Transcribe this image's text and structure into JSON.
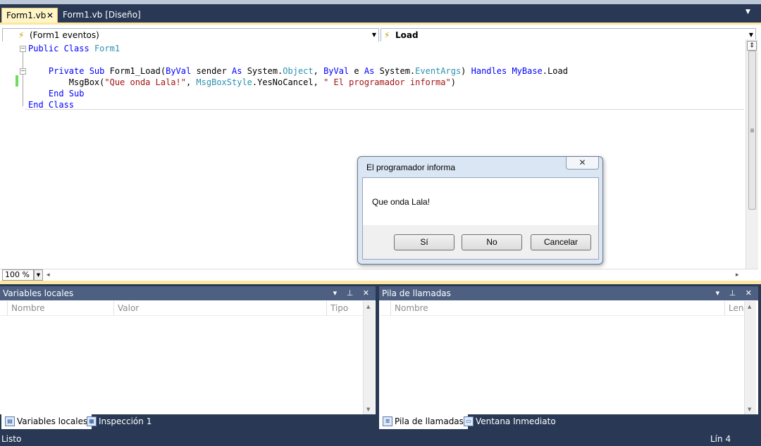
{
  "doc_tabs": {
    "active": "Form1.vb",
    "active_close": "✕",
    "inactive": "Form1.vb [Diseño]"
  },
  "nav": {
    "class_combo": "(Form1 eventos)",
    "method_combo": "Load"
  },
  "code": {
    "line1": {
      "kw1": "Public Class",
      "name": "Form1"
    },
    "line3": {
      "a": "Private Sub",
      "b": " Form1_Load(",
      "c": "ByVal",
      "d": " sender ",
      "e": "As",
      "f": " System.",
      "g": "Object",
      "h": ", ",
      "i": "ByVal",
      "j": " e ",
      "k": "As",
      "l": " System.",
      "m": "EventArgs",
      "n": ") ",
      "o": "Handles",
      "p": " ",
      "q": "MyBase",
      "r": ".Load"
    },
    "line4": {
      "a": "MsgBox(",
      "b": "\"Que onda Lala!\"",
      "c": ", ",
      "d": "MsgBoxStyle",
      "e": ".YesNoCancel, ",
      "f": "\" El programador informa\"",
      "g": ")"
    },
    "line5": "End Sub",
    "line6": "End Class"
  },
  "zoom": "100 %",
  "panes": {
    "locals": {
      "title": "Variables locales",
      "tools": "▾ ⊥ ✕",
      "columns": [
        "Nombre",
        "Valor",
        "Tipo"
      ]
    },
    "callstack": {
      "title": "Pila de llamadas",
      "tools": "▾ ⊥ ✕",
      "columns": [
        "Nombre",
        "Leng"
      ]
    }
  },
  "bottom_tabs": {
    "left": [
      "Variables locales",
      "Inspección 1"
    ],
    "right": [
      "Pila de llamadas",
      "Ventana Inmediato"
    ]
  },
  "status": {
    "text": "Listo",
    "line": "Lín 4"
  },
  "msgbox": {
    "title": "El programador informa",
    "close": "✕",
    "message": "Que onda Lala!",
    "buttons": [
      "Sí",
      "No",
      "Cancelar"
    ]
  }
}
